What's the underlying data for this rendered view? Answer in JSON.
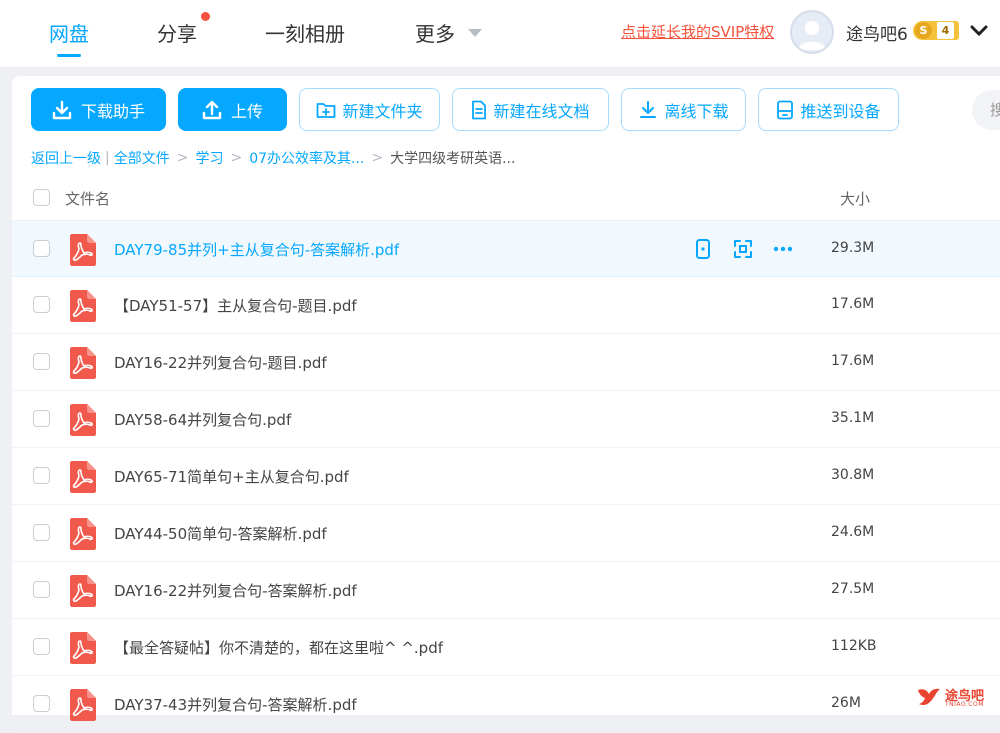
{
  "nav": {
    "tabs": [
      {
        "label": "网盘",
        "active": true
      },
      {
        "label": "分享",
        "badge": true
      },
      {
        "label": "一刻相册"
      },
      {
        "label": "更多"
      }
    ],
    "svip_link": "点击延长我的SVIP特权",
    "username": "途鸟吧6",
    "level_badge": "S",
    "level": "4"
  },
  "toolbar": {
    "download_assistant": "下载助手",
    "upload": "上传",
    "new_folder": "新建文件夹",
    "new_online_doc": "新建在线文档",
    "offline_download": "离线下载",
    "push_to_device": "推送到设备",
    "search_stub": "搜"
  },
  "breadcrumb": {
    "back": "返回上一级",
    "divider": "|",
    "items": [
      "全部文件",
      "学习",
      "07办公效率及其..."
    ],
    "current": "大学四级考研英语...",
    "sep": ">"
  },
  "table": {
    "col_name": "文件名",
    "col_size": "大小",
    "rows": [
      {
        "name": "DAY79-85并列+主从复合句-答案解析.pdf",
        "size": "29.3M",
        "hover": true
      },
      {
        "name": "【DAY51-57】主从复合句-题目.pdf",
        "size": "17.6M"
      },
      {
        "name": "DAY16-22并列复合句-题目.pdf",
        "size": "17.6M"
      },
      {
        "name": "DAY58-64并列复合句.pdf",
        "size": "35.1M"
      },
      {
        "name": "DAY65-71简单句+主从复合句.pdf",
        "size": "30.8M"
      },
      {
        "name": "DAY44-50简单句-答案解析.pdf",
        "size": "24.6M"
      },
      {
        "name": "DAY16-22并列复合句-答案解析.pdf",
        "size": "27.5M"
      },
      {
        "name": "【最全答疑帖】你不清楚的，都在这里啦^ ^.pdf",
        "size": "112KB"
      },
      {
        "name": "DAY37-43并列复合句-答案解析.pdf",
        "size": "26M"
      }
    ]
  },
  "watermark": {
    "text": "途鸟吧",
    "sub": "TNIAO.COM"
  },
  "colors": {
    "accent": "#06a7ff",
    "pdf_red": "#f0594b",
    "link_red": "#f5533d"
  }
}
